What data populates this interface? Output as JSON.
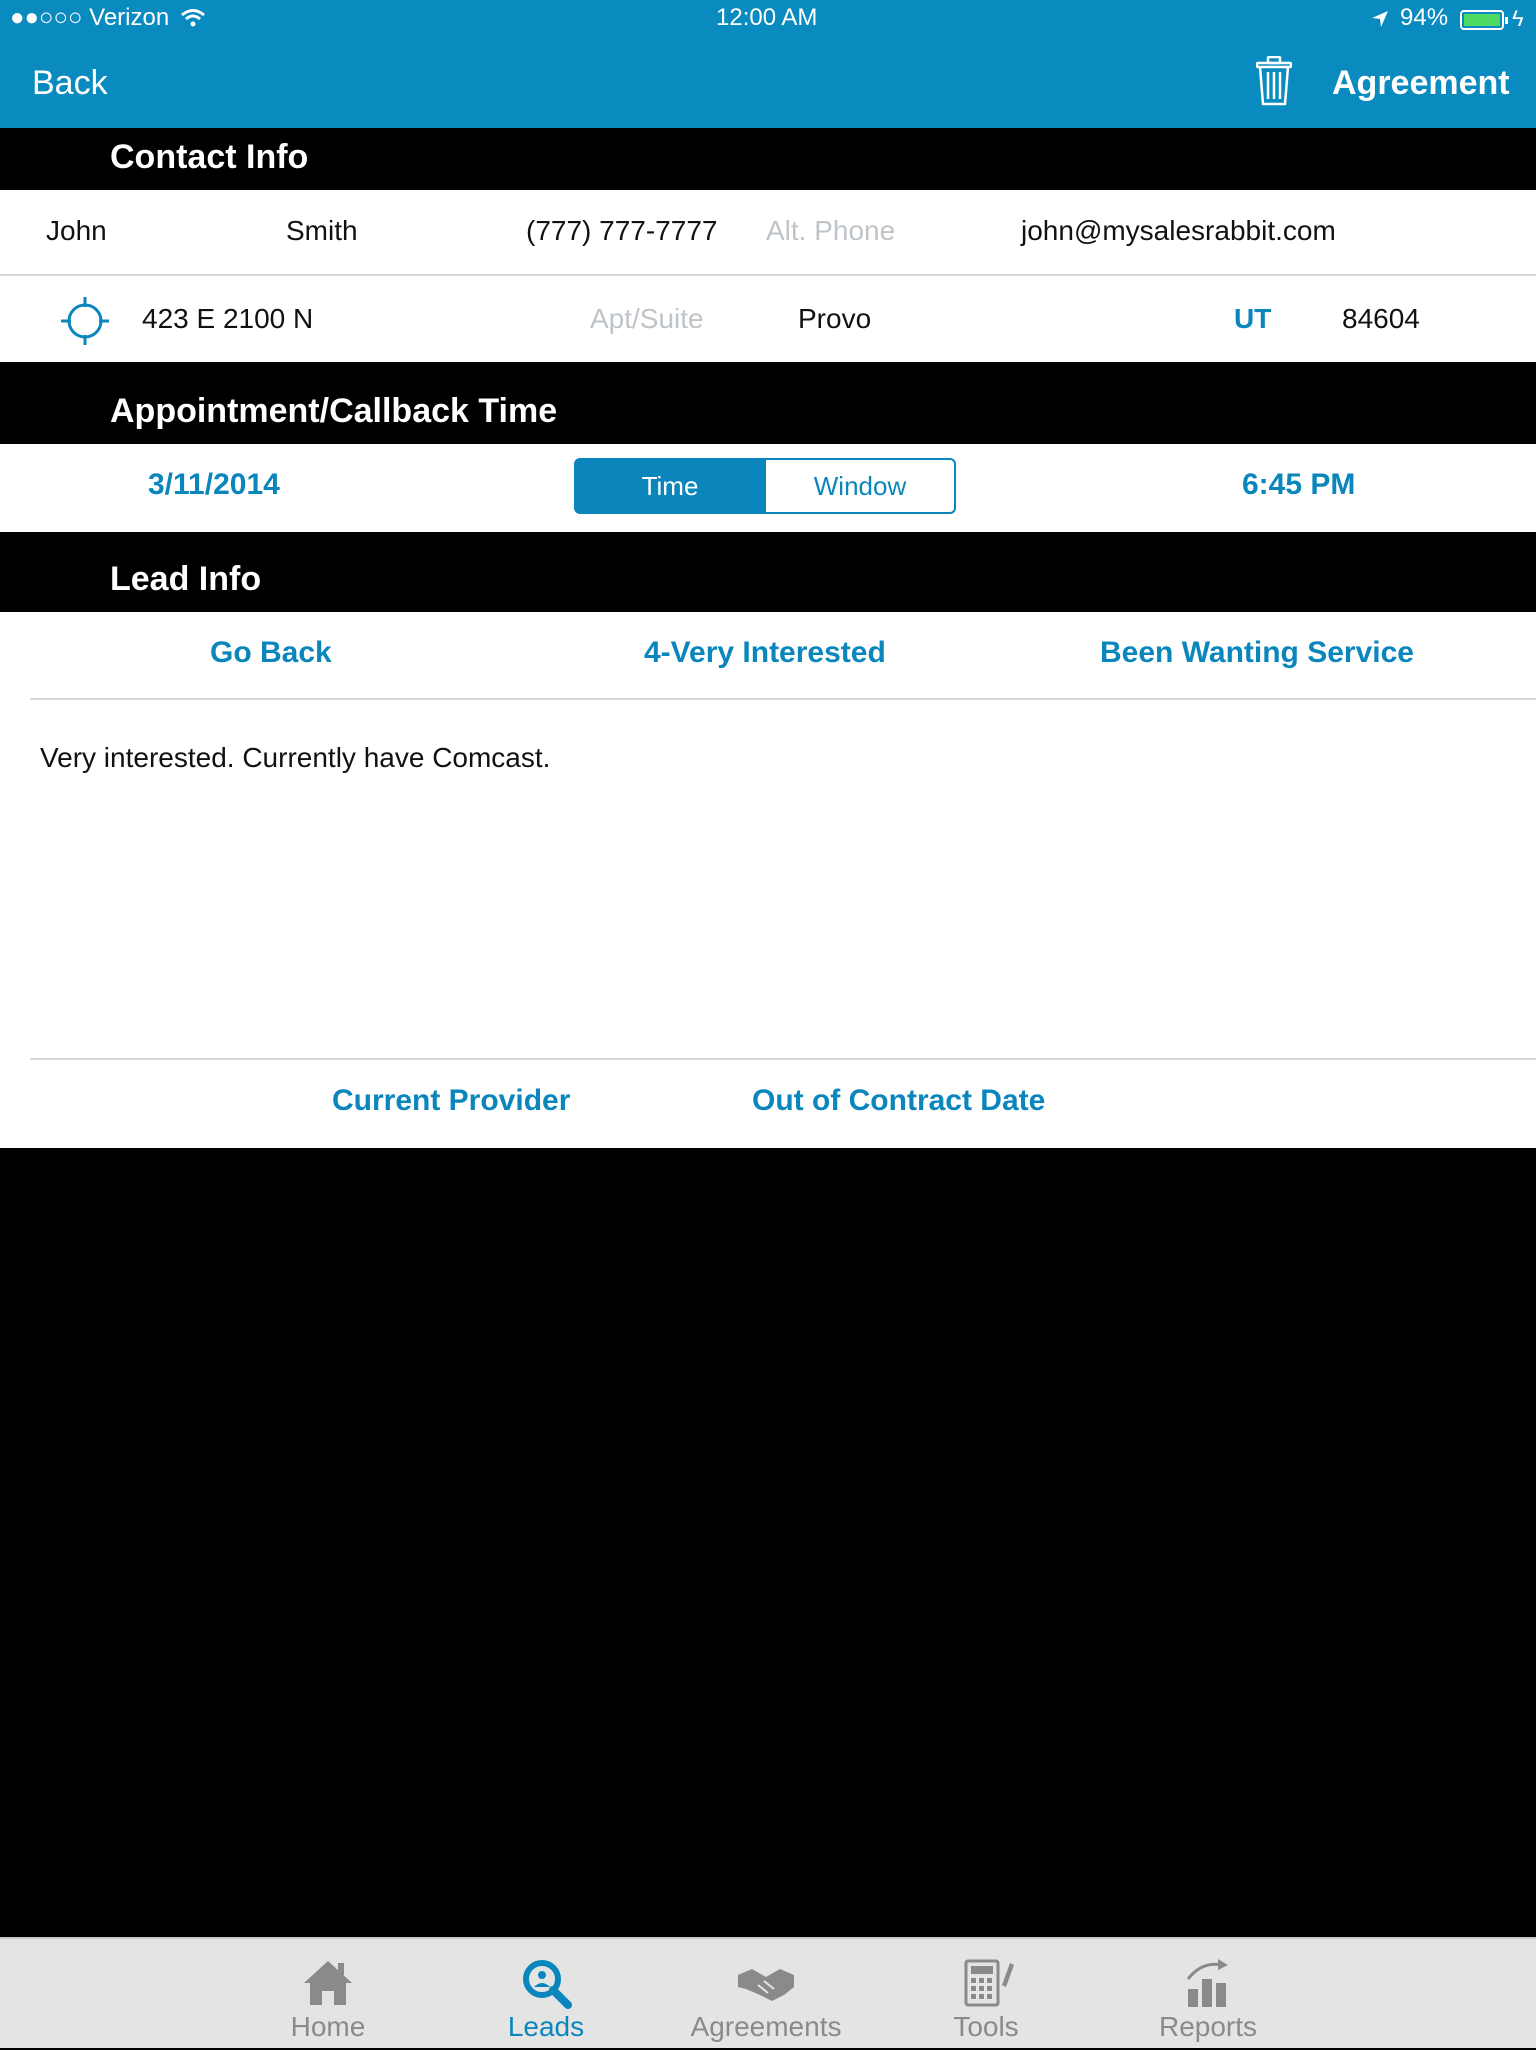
{
  "status_bar": {
    "carrier": "●●○○○ Verizon",
    "time": "12:00 AM",
    "battery": "94%"
  },
  "nav": {
    "back_label": "Back",
    "action_label": "Agreement"
  },
  "contact_info": {
    "header": "Contact Info",
    "first_name": "John",
    "last_name": "Smith",
    "phone": "(777) 777-7777",
    "alt_phone_placeholder": "Alt. Phone",
    "email": "john@mysalesrabbit.com",
    "address": "423 E 2100 N",
    "apt_placeholder": "Apt/Suite",
    "city": "Provo",
    "state": "UT",
    "zip": "84604"
  },
  "appointment": {
    "header": "Appointment/Callback Time",
    "date": "3/11/2014",
    "segments": [
      "Time",
      "Window"
    ],
    "selected_segment": "Time",
    "time": "6:45 PM"
  },
  "lead_info": {
    "header": "Lead Info",
    "status": "Go Back",
    "rating": "4-Very Interested",
    "reason": "Been Wanting Service",
    "notes": "Very interested. Currently have Comcast.",
    "current_provider_label": "Current Provider",
    "contract_date_label": "Out of Contract Date"
  },
  "tabs": [
    {
      "label": "Home",
      "icon": "home-icon"
    },
    {
      "label": "Leads",
      "icon": "search-icon",
      "active": true
    },
    {
      "label": "Agreements",
      "icon": "handshake-icon"
    },
    {
      "label": "Tools",
      "icon": "calculator-icon"
    },
    {
      "label": "Reports",
      "icon": "bar-chart-icon"
    }
  ],
  "colors": {
    "brand": "#0a8bc0",
    "accent": "#0a86bd",
    "battery": "#4cd964"
  }
}
